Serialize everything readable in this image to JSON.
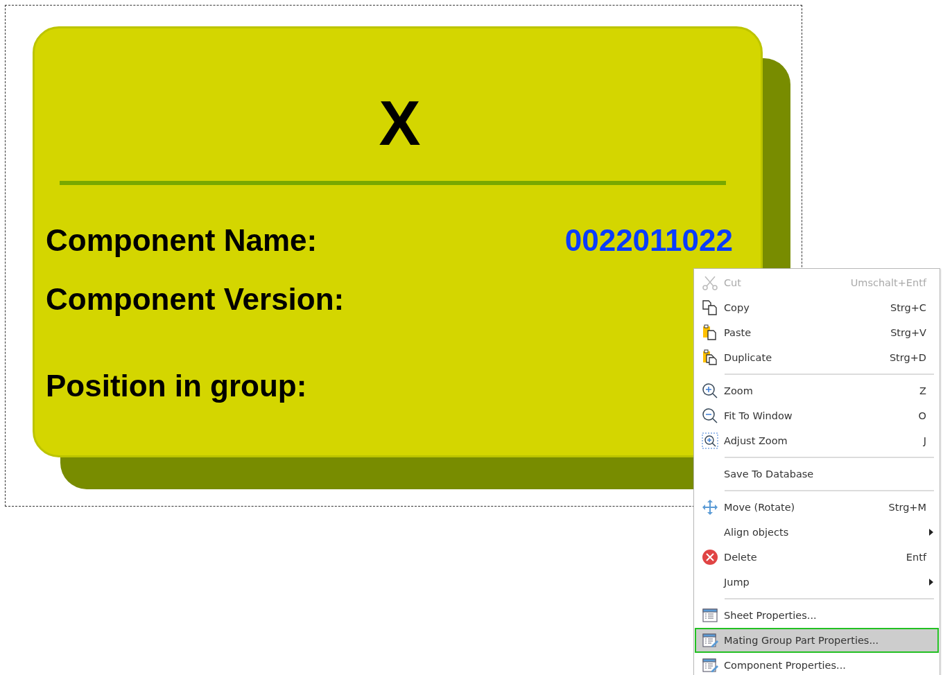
{
  "label_card": {
    "title": "X",
    "fields": [
      {
        "label": "Component Name:",
        "value": "0022011022"
      },
      {
        "label": "Component Version:"
      },
      {
        "label": "Position in group:"
      }
    ]
  },
  "context_menu": {
    "items": [
      {
        "kind": "item",
        "label": "Cut",
        "shortcut": "Umschalt+Entf",
        "disabled": true,
        "selected": false,
        "submenu": false
      },
      {
        "kind": "item",
        "label": "Copy",
        "shortcut": "Strg+C",
        "disabled": false,
        "selected": false,
        "submenu": false
      },
      {
        "kind": "item",
        "label": "Paste",
        "shortcut": "Strg+V",
        "disabled": false,
        "selected": false,
        "submenu": false
      },
      {
        "kind": "item",
        "label": "Duplicate",
        "shortcut": "Strg+D",
        "disabled": false,
        "selected": false,
        "submenu": false
      },
      {
        "kind": "separator"
      },
      {
        "kind": "item",
        "label": "Zoom",
        "shortcut": "Z",
        "disabled": false,
        "selected": false,
        "submenu": false
      },
      {
        "kind": "item",
        "label": "Fit To Window",
        "shortcut": "O",
        "disabled": false,
        "selected": false,
        "submenu": false
      },
      {
        "kind": "item",
        "label": "Adjust Zoom",
        "shortcut": "J",
        "disabled": false,
        "selected": false,
        "submenu": false
      },
      {
        "kind": "separator"
      },
      {
        "kind": "item",
        "label": "Save To Database",
        "disabled": false,
        "selected": false,
        "submenu": false
      },
      {
        "kind": "separator"
      },
      {
        "kind": "item",
        "label": "Move (Rotate)",
        "shortcut": "Strg+M",
        "disabled": false,
        "selected": false,
        "submenu": false
      },
      {
        "kind": "item",
        "label": "Align objects",
        "disabled": false,
        "selected": false,
        "submenu": true
      },
      {
        "kind": "item",
        "label": "Delete",
        "shortcut": "Entf",
        "disabled": false,
        "selected": false,
        "submenu": false
      },
      {
        "kind": "item",
        "label": "Jump",
        "disabled": false,
        "selected": false,
        "submenu": true
      },
      {
        "kind": "separator"
      },
      {
        "kind": "item",
        "label": "Sheet Properties...",
        "disabled": false,
        "selected": false,
        "submenu": false
      },
      {
        "kind": "item",
        "label": "Mating Group Part Properties...",
        "disabled": false,
        "selected": true,
        "submenu": false
      },
      {
        "kind": "item",
        "label": "Component Properties...",
        "disabled": false,
        "selected": false,
        "submenu": false
      }
    ]
  }
}
